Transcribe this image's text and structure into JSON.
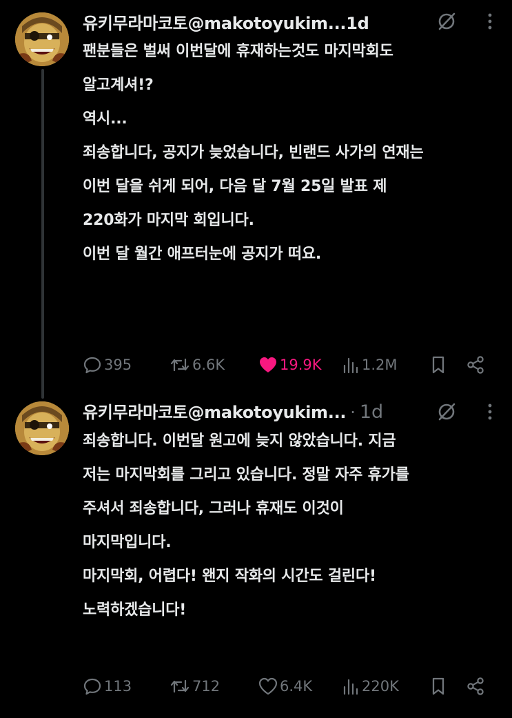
{
  "colors": {
    "background": "#000000",
    "text": "#e7e9ea",
    "muted": "#71767b",
    "like_active": "#f91880",
    "thread_line": "#2f3336"
  },
  "posts": [
    {
      "display_name": "유키무라마코토",
      "handle_time": "@makotoyukim...1d",
      "separator": "",
      "time": "",
      "lines": [
        "팬분들은 벌써 이번달에 휴재하는것도 마지막회도",
        "알고계셔!?",
        "역시...",
        "죄송합니다, 공지가 늦었습니다, 빈랜드 사가의 연재는",
        "이번 달을 쉬게 되어, 다음 달 7월 25일 발표 제",
        "220화가 마지막 회입니다.",
        "이번 달 월간 애프터눈에 공지가 떠요."
      ],
      "actions": {
        "replies": "395",
        "reposts": "6.6K",
        "likes": "19.9K",
        "views": "1.2M"
      },
      "liked": true,
      "icons": [
        "grok-icon",
        "more-icon",
        "reply-icon",
        "repost-icon",
        "like-icon",
        "views-icon",
        "bookmark-icon",
        "share-icon"
      ]
    },
    {
      "display_name": "유키무라마코토",
      "handle_time": "@makotoyukim...",
      "separator": "·",
      "time": "1d",
      "lines": [
        "죄송합니다. 이번달 원고에 늦지 않았습니다. 지금",
        "저는 마지막회를 그리고 있습니다. 정말 자주 휴가를",
        "주셔서 죄송합니다, 그러나 휴재도 이것이",
        "마지막입니다.",
        "마지막회, 어렵다! 왠지 작화의 시간도 걸린다!",
        "노력하겠습니다!"
      ],
      "actions": {
        "replies": "113",
        "reposts": "712",
        "likes": "6.4K",
        "views": "220K"
      },
      "liked": false,
      "icons": [
        "grok-icon",
        "more-icon",
        "reply-icon",
        "repost-icon",
        "like-icon",
        "views-icon",
        "bookmark-icon",
        "share-icon"
      ]
    }
  ]
}
